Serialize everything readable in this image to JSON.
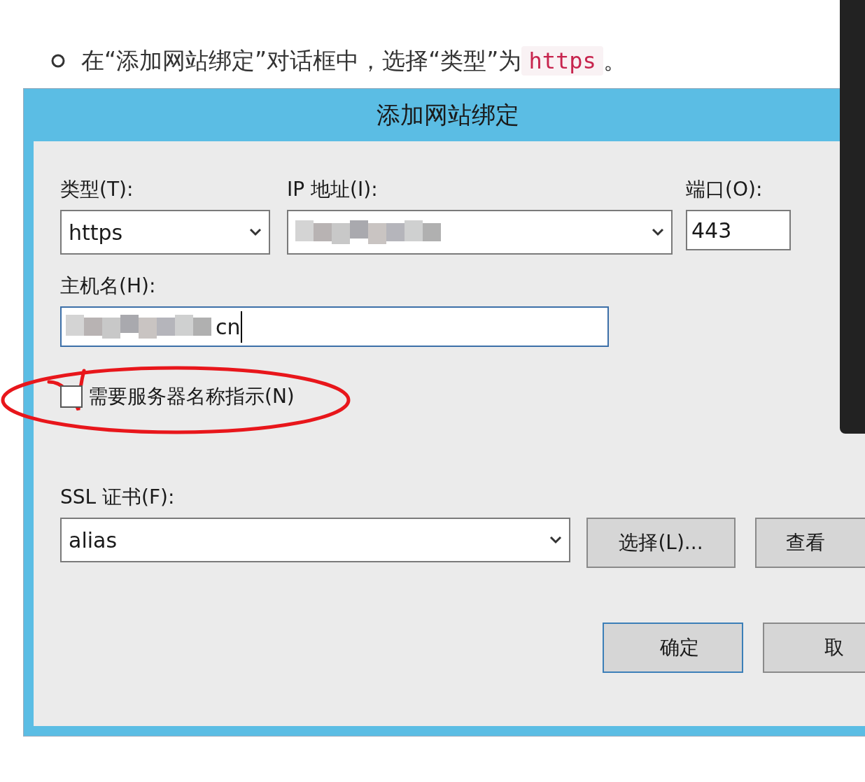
{
  "instruction": {
    "text": "在“添加网站绑定”对话框中，选择“类型”为",
    "code": "https",
    "end": "。"
  },
  "dialog": {
    "title": "添加网站绑定",
    "type": {
      "label": "类型(T):",
      "value": "https"
    },
    "ip": {
      "label": "IP 地址(I):",
      "redacted": true
    },
    "port": {
      "label": "端口(O):",
      "value": "443"
    },
    "host": {
      "label": "主机名(H):",
      "redacted": true,
      "value": "cn"
    },
    "sni": {
      "label": "需要服务器名称指示(N)",
      "checked": false
    },
    "ssl": {
      "label": "SSL 证书(F):",
      "value": "alias"
    },
    "buttons": [
      {
        "label": "选择(L)...",
        "kind": "ssl"
      },
      {
        "label": "查看",
        "kind": "ssl"
      },
      {
        "label": "确定",
        "kind": "footer",
        "default": true
      },
      {
        "label": "取",
        "kind": "footer",
        "default": false
      }
    ]
  },
  "annotation": {
    "kind": "circled-check"
  }
}
